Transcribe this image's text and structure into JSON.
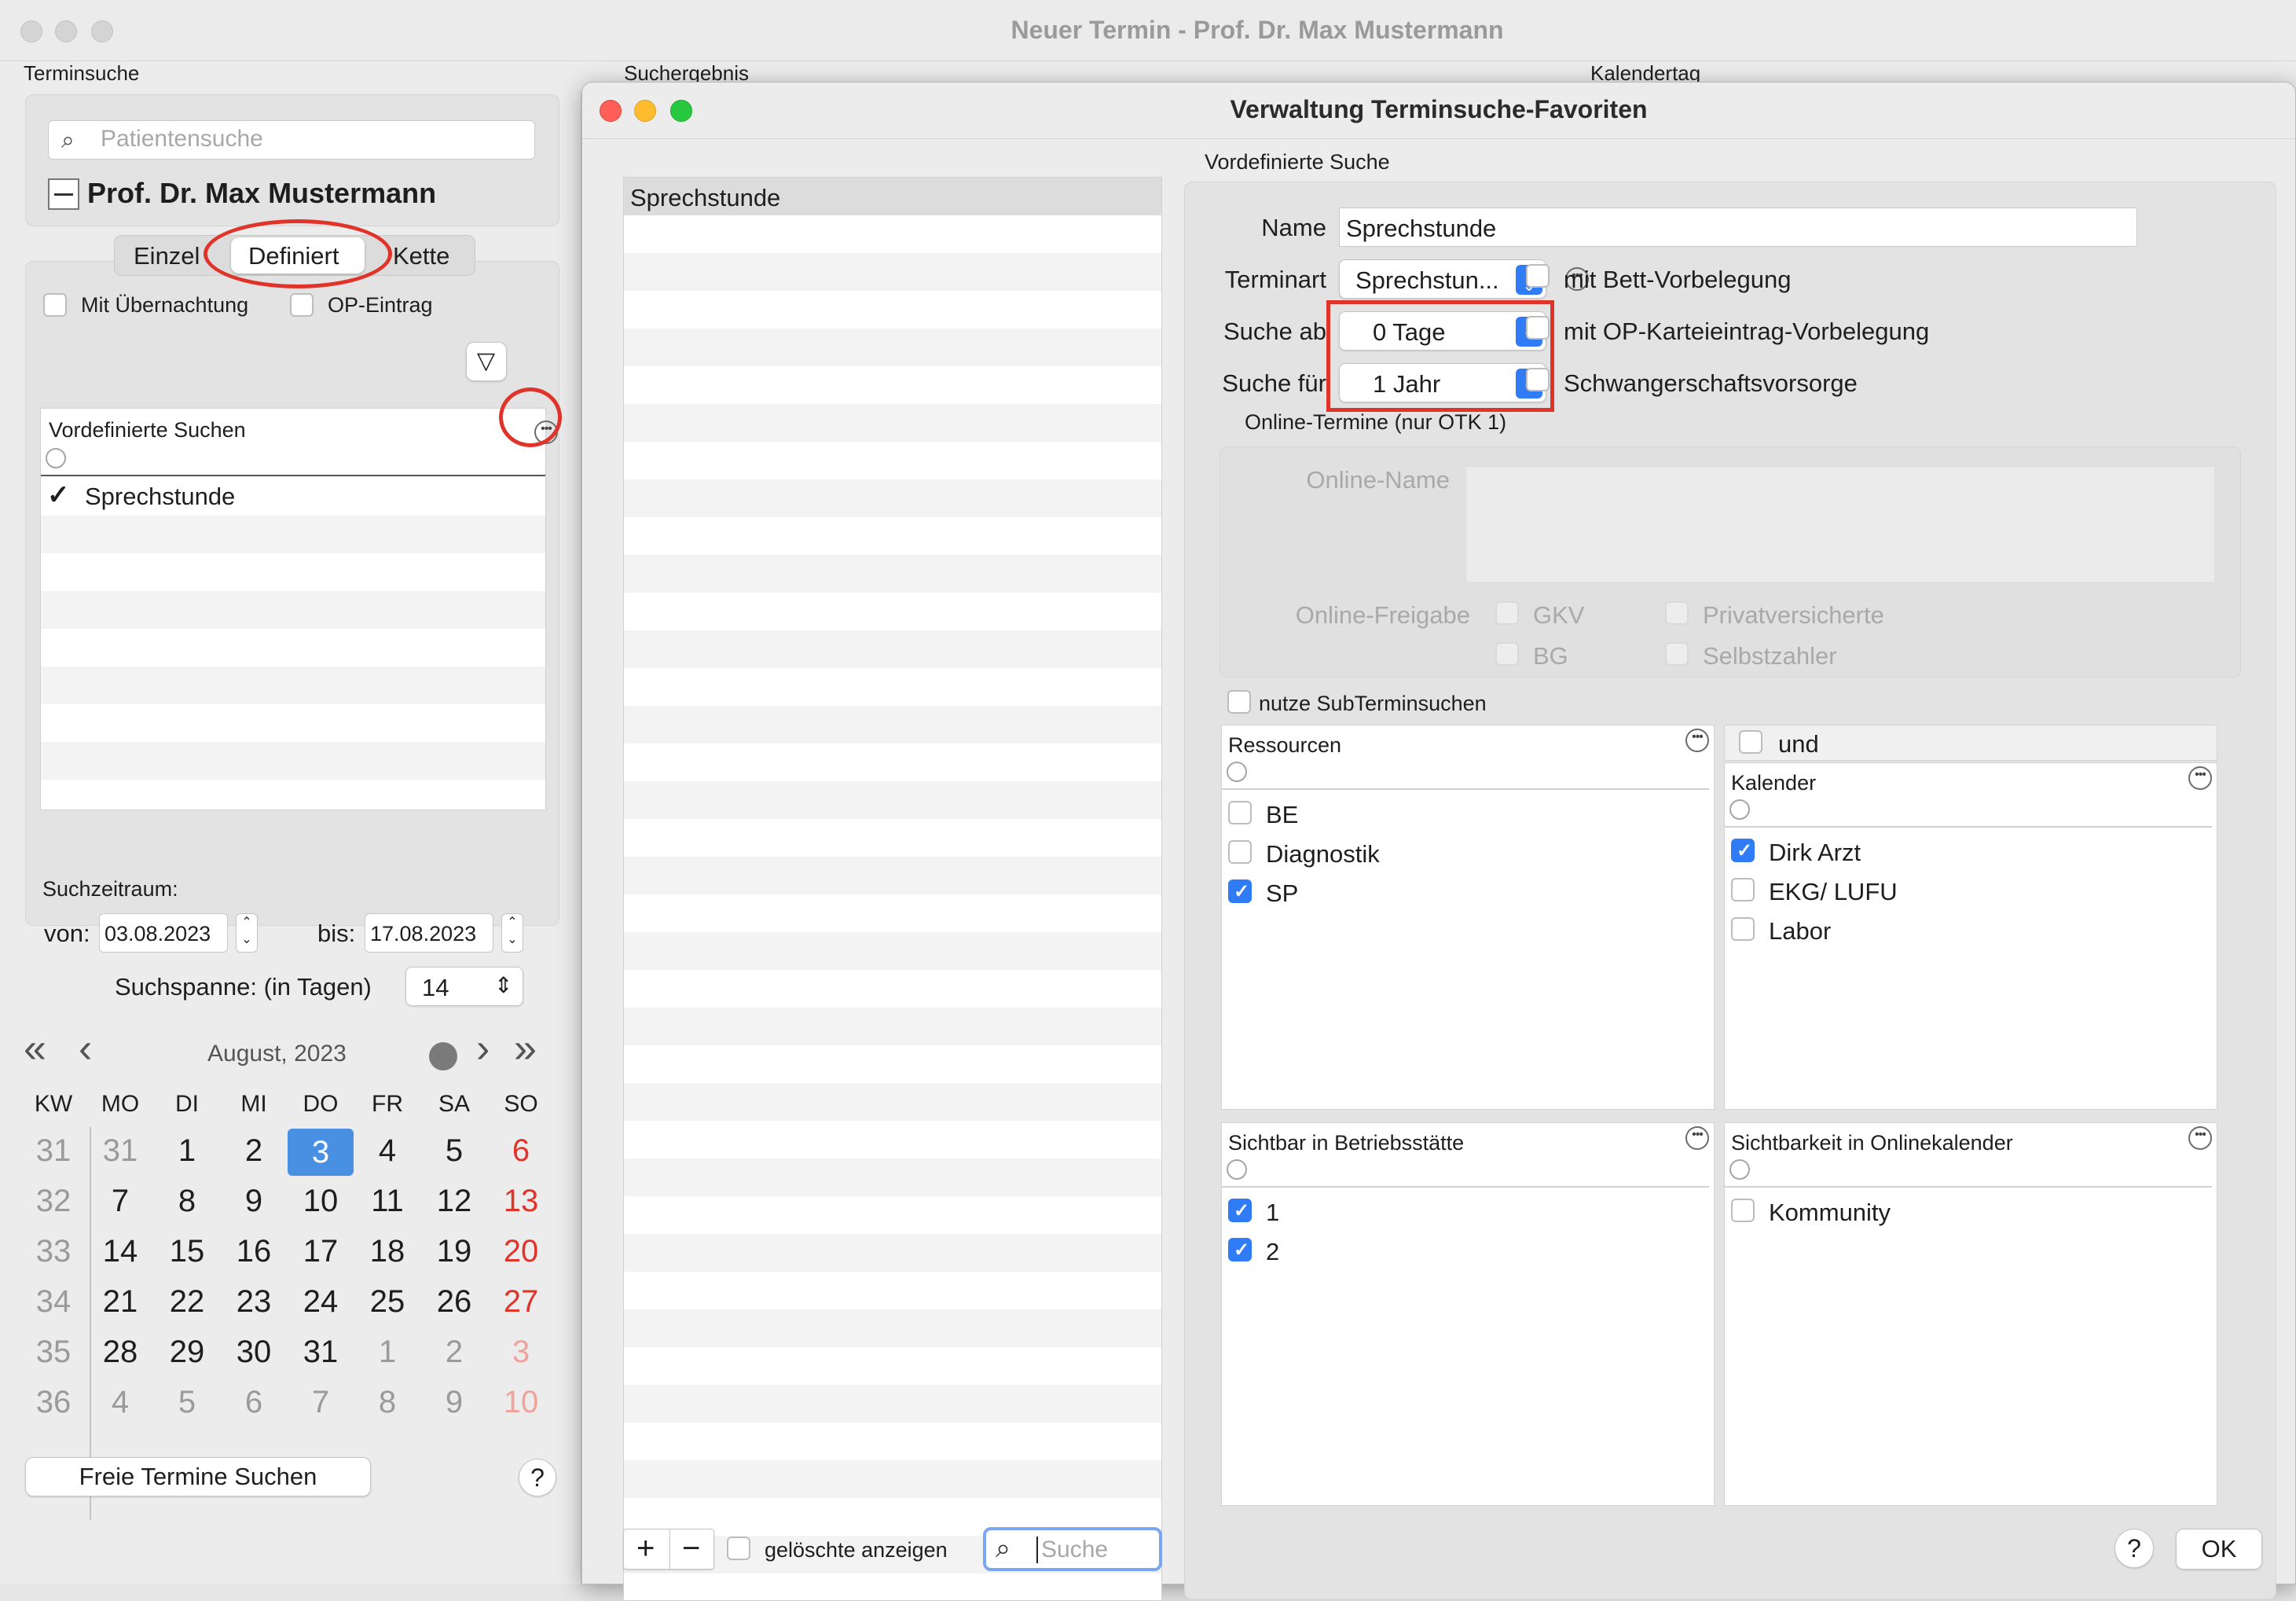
{
  "window": {
    "title": "Neuer Termin - Prof. Dr. Max Mustermann",
    "section_left": "Terminsuche",
    "section_middle": "Suchergebnis",
    "section_right": "Kalendertag"
  },
  "left": {
    "search_placeholder": "Patientensuche",
    "patient_name": "Prof. Dr. Max Mustermann",
    "tabs": [
      "Einzel",
      "Definiert",
      "Kette"
    ],
    "active_tab": "Definiert",
    "checkbox_overnight": "Mit Übernachtung",
    "checkbox_op": "OP-Eintrag",
    "list_header": "Vordefinierte Suchen",
    "list_items": [
      {
        "label": "Sprechstunde",
        "checked": true
      }
    ],
    "search_period_label": "Suchzeitraum:",
    "from_label": "von:",
    "from_value": "03.08.2023",
    "to_label": "bis:",
    "to_value": "17.08.2023",
    "span_label": "Suchspanne: (in Tagen)",
    "span_value": "14",
    "calendar": {
      "month": "August, 2023",
      "headers": [
        "KW",
        "MO",
        "DI",
        "MI",
        "DO",
        "FR",
        "SA",
        "SO"
      ],
      "weeks": [
        {
          "kw": "31",
          "days": [
            "31",
            "1",
            "2",
            "3",
            "4",
            "5",
            "6"
          ]
        },
        {
          "kw": "32",
          "days": [
            "7",
            "8",
            "9",
            "10",
            "11",
            "12",
            "13"
          ]
        },
        {
          "kw": "33",
          "days": [
            "14",
            "15",
            "16",
            "17",
            "18",
            "19",
            "20"
          ]
        },
        {
          "kw": "34",
          "days": [
            "21",
            "22",
            "23",
            "24",
            "25",
            "26",
            "27"
          ]
        },
        {
          "kw": "35",
          "days": [
            "28",
            "29",
            "30",
            "31",
            "1",
            "2",
            "3"
          ]
        },
        {
          "kw": "36",
          "days": [
            "4",
            "5",
            "6",
            "7",
            "8",
            "9",
            "10"
          ]
        }
      ],
      "selected": "3"
    },
    "find_button": "Freie Termine Suchen",
    "help": "?"
  },
  "dialog": {
    "title": "Verwaltung Terminsuche-Favoriten",
    "list_items": [
      "Sprechstunde"
    ],
    "add": "+",
    "remove": "−",
    "show_deleted": "gelöschte anzeigen",
    "search_placeholder": "Suche",
    "section_title": "Vordefinierte Suche",
    "name_label": "Name",
    "name_value": "Sprechstunde",
    "type_label": "Terminart",
    "type_value": "Sprechstun...",
    "search_from_label": "Suche ab",
    "search_from_value": "0 Tage",
    "search_for_label": "Suche für",
    "search_for_value": "1 Jahr",
    "opt_bed": "mit Bett-Vorbelegung",
    "opt_op": "mit OP-Karteieintrag-Vorbelegung",
    "opt_pregnancy": "Schwangerschaftsvorsorge",
    "online_title": "Online-Termine (nur OTK 1)",
    "online_name_label": "Online-Name",
    "online_release_label": "Online-Freigabe",
    "online_opts": [
      "GKV",
      "BG",
      "Privatversicherte",
      "Selbstzahler"
    ],
    "sub_search": "nutze SubTerminsuchen",
    "resources_header": "Ressourcen",
    "resources": [
      {
        "label": "BE",
        "checked": false
      },
      {
        "label": "Diagnostik",
        "checked": false
      },
      {
        "label": "SP",
        "checked": true
      }
    ],
    "and_label": "und",
    "calendar_header": "Kalender",
    "calendars": [
      {
        "label": "Dirk Arzt",
        "checked": true
      },
      {
        "label": "EKG/ LUFU",
        "checked": false
      },
      {
        "label": "Labor",
        "checked": false
      }
    ],
    "visible_site_header": "Sichtbar in Betriebsstätte",
    "sites": [
      {
        "label": "1",
        "checked": true
      },
      {
        "label": "2",
        "checked": true
      }
    ],
    "visible_online_header": "Sichtbarkeit in Onlinekalender",
    "online_cals": [
      {
        "label": "Kommunity",
        "checked": false
      }
    ],
    "help": "?",
    "ok": "OK"
  },
  "colors": {
    "accent": "#2f7cf6",
    "highlight": "#e0342a",
    "selected_day": "#4a90e2"
  }
}
